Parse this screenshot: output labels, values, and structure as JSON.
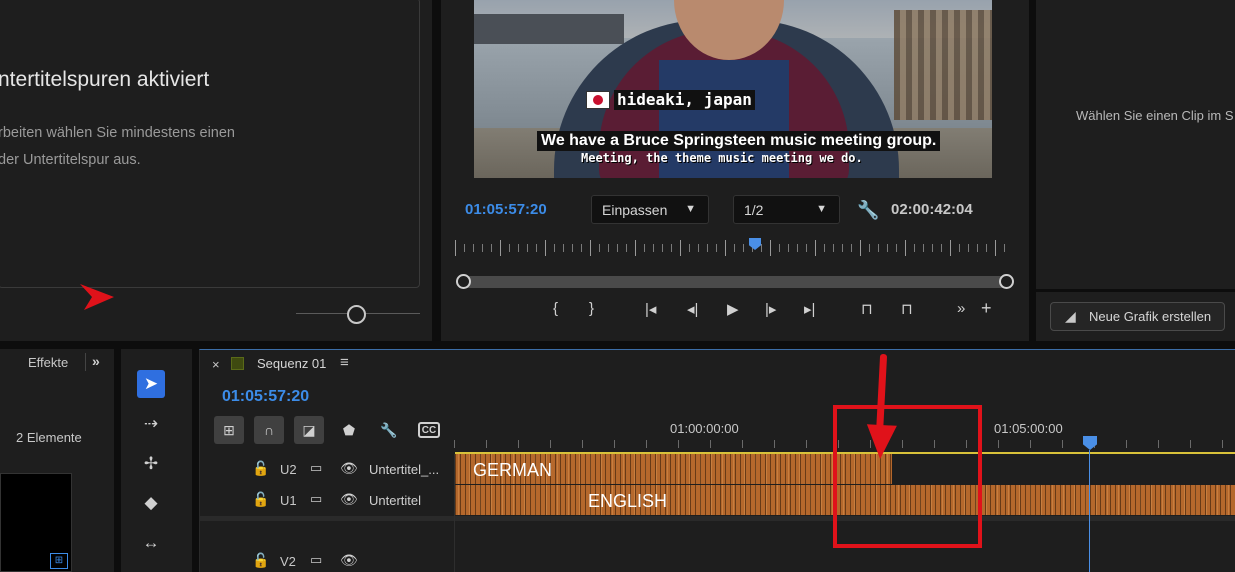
{
  "info_panel": {
    "title": "ntertitelspuren aktiviert",
    "body": "rbeiten wählen Sie mindestens einen\nder Untertitelspur aus."
  },
  "monitor": {
    "caption_name": "hideaki, japan",
    "caption_en": "We have a Bruce Springsteen music meeting group.",
    "caption_de": "Meeting, the theme music meeting we do.",
    "timecode_current": "01:05:57:20",
    "fit_option": "Einpassen",
    "resolution_option": "1/2",
    "timecode_duration": "02:00:42:04",
    "transport_icons": [
      "mark-in-icon",
      "mark-out-icon",
      "go-to-in-icon",
      "step-back-icon",
      "play-icon",
      "step-forward-icon",
      "go-to-out-icon",
      "lift-icon",
      "extract-icon",
      "more-icon",
      "add-icon"
    ],
    "playhead_fraction": 0.53
  },
  "right_panel": {
    "message": "Wählen Sie einen Clip im S",
    "new_graphic_label": "Neue Grafik erstellen"
  },
  "effects_panel": {
    "tab_label": "Effekte",
    "count_label": "2 Elemente"
  },
  "timeline": {
    "sequence_name": "Sequenz 01",
    "timecode": "01:05:57:20",
    "ruler_labels": [
      "01:00:00:00",
      "01:05:00:00"
    ],
    "tracks": [
      {
        "id": "U2",
        "label": "Untertitel_..."
      },
      {
        "id": "U1",
        "label": "Untertitel"
      },
      {
        "id": "V2",
        "label": ""
      }
    ],
    "clip_labels": {
      "u2": "GERMAN",
      "u1": "ENGLISH"
    }
  },
  "colors": {
    "accent_blue": "#3c8ce8",
    "clip_orange": "#b5682c",
    "annotation_red": "#e0121a",
    "sequence_color": "#3f4a10"
  }
}
